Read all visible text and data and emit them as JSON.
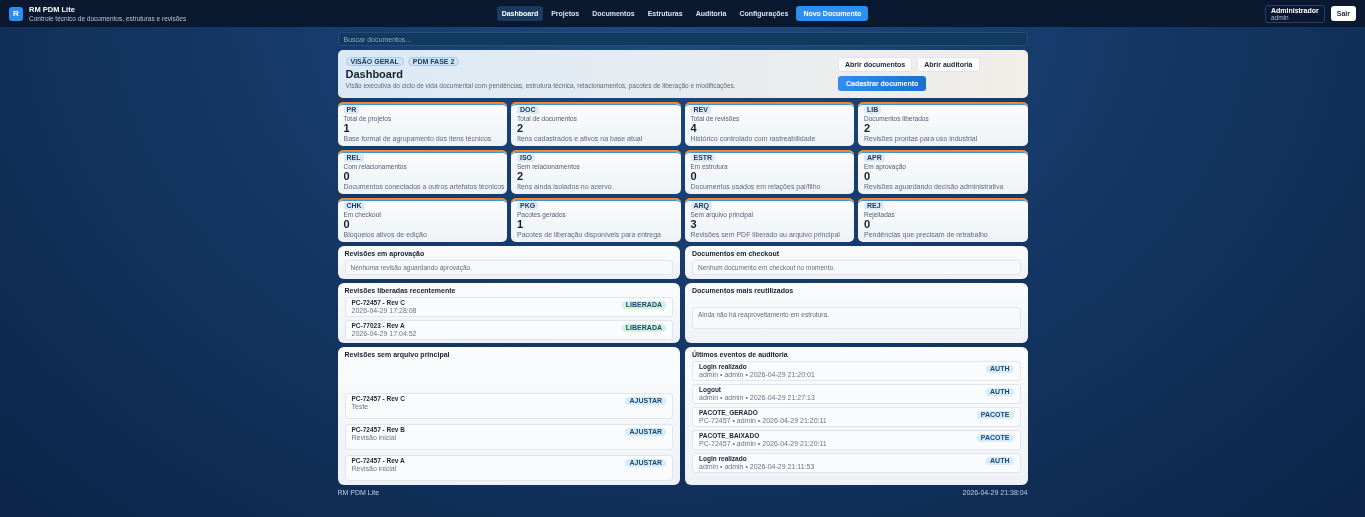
{
  "header": {
    "logo": "R",
    "app_name": "RM PDM Lite",
    "subtitle": "Controle técnico de documentos, estruturas e revisões",
    "nav": [
      {
        "label": "Dashboard",
        "selected": true
      },
      {
        "label": "Projetos",
        "selected": false
      },
      {
        "label": "Documentos",
        "selected": false
      },
      {
        "label": "Estruturas",
        "selected": false
      },
      {
        "label": "Auditoria",
        "selected": false
      },
      {
        "label": "Configurações",
        "selected": false
      }
    ],
    "primary_action": "Novo Documento",
    "user": {
      "name": "Administrador",
      "login": "admin"
    },
    "logout": "Sair"
  },
  "search": {
    "placeholder": "Buscar documentos..."
  },
  "hero": {
    "badges": [
      "VISÃO GERAL",
      "PDM FASE 2"
    ],
    "title": "Dashboard",
    "description": "Visão executiva do ciclo de vida documental com pendências, estrutura técnica, relacionamentos, pacotes de liberação e modificações.",
    "buttons": [
      "Abrir documentos",
      "Abrir auditoria"
    ],
    "primary_button": "Cadastrar documento"
  },
  "stats": [
    {
      "code": "PR",
      "label": "Total de projetos",
      "value": "1",
      "description": "Base formal de agrupamento dos itens técnicos"
    },
    {
      "code": "DOC",
      "label": "Total de documentos",
      "value": "2",
      "description": "Itens cadastrados e ativos na base atual"
    },
    {
      "code": "REV",
      "label": "Total de revisões",
      "value": "4",
      "description": "Histórico controlado com rastreabilidade"
    },
    {
      "code": "LIB",
      "label": "Documentos liberados",
      "value": "2",
      "description": "Revisões prontas para uso industrial"
    },
    {
      "code": "REL",
      "label": "Com relacionamentos",
      "value": "0",
      "description": "Documentos conectados a outros artefatos técnicos"
    },
    {
      "code": "ISO",
      "label": "Sem relacionamentos",
      "value": "2",
      "description": "Itens ainda isolados no acervo"
    },
    {
      "code": "ESTR",
      "label": "Em estrutura",
      "value": "0",
      "description": "Documentos usados em relações pai/filho"
    },
    {
      "code": "APR",
      "label": "Em aprovação",
      "value": "0",
      "description": "Revisões aguardando decisão administrativa"
    },
    {
      "code": "CHK",
      "label": "Em checkout",
      "value": "0",
      "description": "Bloqueios ativos de edição"
    },
    {
      "code": "PKG",
      "label": "Pacotes gerados",
      "value": "1",
      "description": "Pacotes de liberação disponíveis para entrega"
    },
    {
      "code": "ARQ",
      "label": "Sem arquivo principal",
      "value": "3",
      "description": "Revisões sem PDF liberado ou arquivo principal"
    },
    {
      "code": "REJ",
      "label": "Rejeitadas",
      "value": "0",
      "description": "Pendências que precisam de retrabalho"
    }
  ],
  "panels": [
    {
      "title": "Revisões em aprovação",
      "empty": "Nenhuma revisão aguardando aprovação."
    },
    {
      "title": "Documentos em checkout",
      "empty": "Nenhum documento em checkout no momento."
    },
    {
      "title": "Revisões liberadas recentemente",
      "items": [
        {
          "title": "PC-72457 - Rev C",
          "meta": "2026-04-29 17:28:08",
          "tag": "LIBERADA",
          "color": "#d3f2dc"
        },
        {
          "title": "PC-77023 - Rev A",
          "meta": "2026-04-29 17:04:52",
          "tag": "LIBERADA",
          "color": "#d3f2dc"
        }
      ]
    },
    {
      "title": "Documentos mais reutilizados",
      "empty": "Ainda não há reaproveitamento em estrutura."
    },
    {
      "title": "Revisões sem arquivo principal",
      "items": [
        {
          "title": "PC-72457 - Rev C",
          "meta": "Teste",
          "tag": "AJUSTAR",
          "color": "#d6ecfb"
        },
        {
          "title": "PC-72457 - Rev B",
          "meta": "Revisão inicial",
          "tag": "AJUSTAR",
          "color": "#d6ecfb"
        },
        {
          "title": "PC-72457 - Rev A",
          "meta": "Revisão inicial",
          "tag": "AJUSTAR",
          "color": "#d6ecfb"
        }
      ]
    },
    {
      "title": "Últimos eventos de auditoria",
      "items": [
        {
          "title": "Login realizado",
          "meta": "admin • admin • 2026-04-29 21:20:01",
          "tag": "AUTH",
          "color": "#d6ecfb"
        },
        {
          "title": "Logout",
          "meta": "admin • admin • 2026-04-29 21:27:13",
          "tag": "AUTH",
          "color": "#d6ecfb"
        },
        {
          "title": "PACOTE_GERADO",
          "meta": "PC-72457 • admin • 2026-04-29 21:20:11",
          "tag": "PACOTE",
          "color": "#d6ecfb"
        },
        {
          "title": "PACOTE_BAIXADO",
          "meta": "PC-72457 • admin • 2026-04-29 21:20:11",
          "tag": "PACOTE",
          "color": "#d6ecfb"
        },
        {
          "title": "Login realizado",
          "meta": "admin • admin • 2026-04-29 21:11:53",
          "tag": "AUTH",
          "color": "#d6ecfb"
        }
      ]
    }
  ],
  "footer": {
    "left": "RM PDM Lite",
    "right": "2026-04-29 21:38:04"
  }
}
